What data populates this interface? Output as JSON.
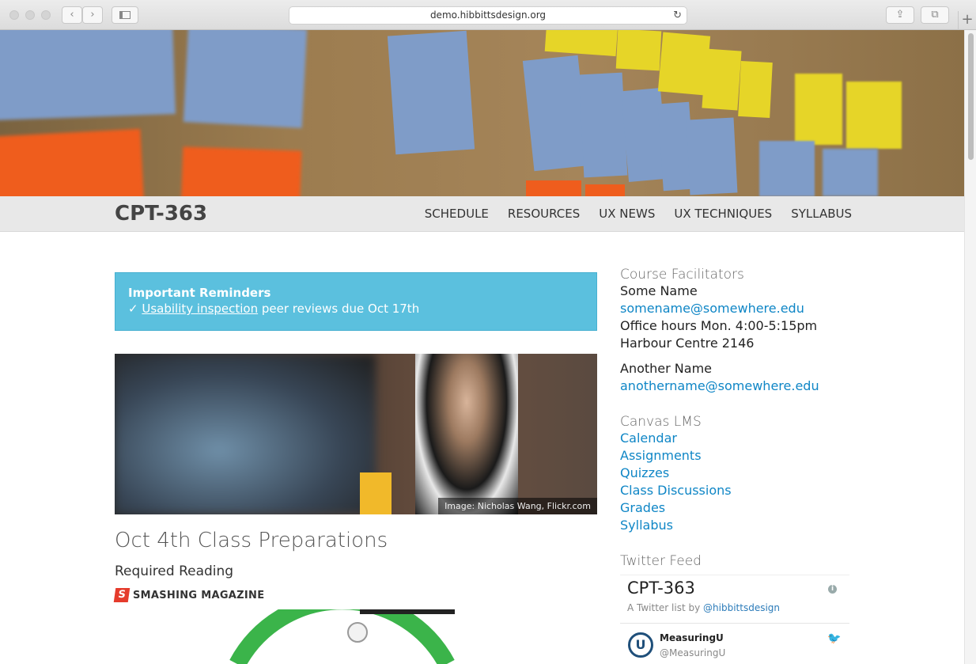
{
  "browser": {
    "url": "demo.hibbittsdesign.org",
    "back_glyph": "‹",
    "forward_glyph": "›",
    "reload_glyph": "↻",
    "share_glyph": "⇪",
    "tabs_glyph": "⧉",
    "newtab_glyph": "+"
  },
  "site": {
    "brand": "CPT-363",
    "nav": [
      "SCHEDULE",
      "RESOURCES",
      "UX NEWS",
      "UX TECHNIQUES",
      "SYLLABUS"
    ]
  },
  "reminder": {
    "title": "Important Reminders",
    "check": "✓",
    "link_text": "Usability inspection",
    "rest_text": " peer reviews due Oct 17th"
  },
  "photo": {
    "credit": "Image: Nicholas Wang, Flickr.com"
  },
  "main": {
    "heading": "Oct 4th Class Preparations",
    "subheading": "Required Reading",
    "source_logo": "S",
    "source_name": "SMASHING MAGAZINE"
  },
  "sidebar": {
    "facilitators_heading": "Course Facilitators",
    "person1": {
      "name": "Some Name",
      "email": "somename@somewhere.edu",
      "hours": "Office hours Mon. 4:00-5:15pm",
      "room": "Harbour Centre 2146"
    },
    "person2": {
      "name": "Another Name",
      "email": "anothername@somewhere.edu"
    },
    "lms_heading": "Canvas LMS",
    "lms_links": [
      "Calendar",
      "Assignments",
      "Quizzes",
      "Class Discussions",
      "Grades",
      "Syllabus"
    ],
    "twitter_heading": "Twitter Feed",
    "twitter": {
      "list_title": "CPT-363",
      "info_glyph": "i",
      "by_prefix": "A Twitter list by ",
      "by_handle": "@hibbittsdesign",
      "tweet_avatar": "U",
      "tweet_name": "MeasuringU",
      "tweet_handle": "@MeasuringU",
      "bird_glyph": "🐦"
    }
  }
}
